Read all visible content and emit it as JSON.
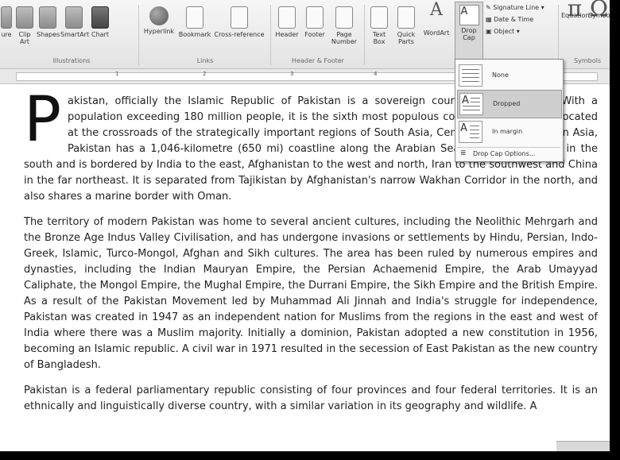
{
  "ribbon": {
    "groups": {
      "illustrations": {
        "label": "Illustrations",
        "buttons": [
          "ure",
          "Clip Art",
          "Shapes",
          "SmartArt",
          "Chart"
        ]
      },
      "links": {
        "label": "Links",
        "buttons": [
          "Hyperlink",
          "Bookmark",
          "Cross-reference"
        ]
      },
      "header_footer": {
        "label": "Header & Footer",
        "buttons": [
          "Header",
          "Footer",
          "Page Number"
        ]
      },
      "text": {
        "buttons": [
          "Text Box",
          "Quick Parts",
          "WordArt",
          "Drop Cap"
        ],
        "small": [
          "Signature Line",
          "Date & Time",
          "Object"
        ]
      },
      "symbols": {
        "label": "Symbols",
        "buttons": [
          "Equation",
          "Symbol"
        ],
        "glyph_pi": "π",
        "glyph_omega": "Ω"
      }
    }
  },
  "ruler": {
    "numbers": [
      "1",
      "2",
      "3",
      "4"
    ]
  },
  "drop_cap_menu": {
    "items": [
      {
        "label": "None",
        "selected": false
      },
      {
        "label": "Dropped",
        "selected": true
      },
      {
        "label": "In margin",
        "selected": false
      }
    ],
    "options_label": "Drop Cap Options..."
  },
  "document": {
    "drop_cap_letter": "P",
    "paragraphs": [
      "akistan, officially the Islamic Republic of Pakistan is a sovereign country in South Asia. With a population exceeding 180 million people, it is the sixth most populous country in the world. Located at the crossroads of the strategically important regions of South Asia, Central Asia and Western Asia, Pakistan has a 1,046-kilometre (650 mi) coastline along the Arabian Sea and Gulf of Oman in the south and is bordered by India to the east, Afghanistan to the west and north, Iran to the southwest and China in the far northeast. It is separated from Tajikistan by Afghanistan's narrow Wakhan Corridor in the north, and also shares a marine border with Oman.",
      "The territory of modern Pakistan was home to several ancient cultures, including the Neolithic Mehrgarh and the Bronze Age Indus Valley Civilisation, and has undergone invasions or settlements by Hindu, Persian, Indo-Greek, Islamic, Turco-Mongol, Afghan and Sikh cultures. The area has been ruled by numerous empires and dynasties, including the Indian Mauryan Empire, the Persian Achaemenid Empire, the Arab Umayyad Caliphate, the Mongol Empire, the Mughal Empire, the Durrani Empire, the Sikh Empire and the British Empire. As a result of the Pakistan Movement led by Muhammad Ali Jinnah and India's struggle for independence, Pakistan was created in 1947 as an independent nation for Muslims from the regions in the east and west of India where there was a Muslim majority. Initially a dominion, Pakistan adopted a new constitution in 1956, becoming an Islamic republic. A civil war in 1971 resulted in the secession of East Pakistan as the new country of Bangladesh.",
      "Pakistan is a federal parliamentary republic consisting of four provinces and four federal territories. It is an ethnically and linguistically diverse country, with a similar variation in its geography and wildlife. A"
    ]
  }
}
